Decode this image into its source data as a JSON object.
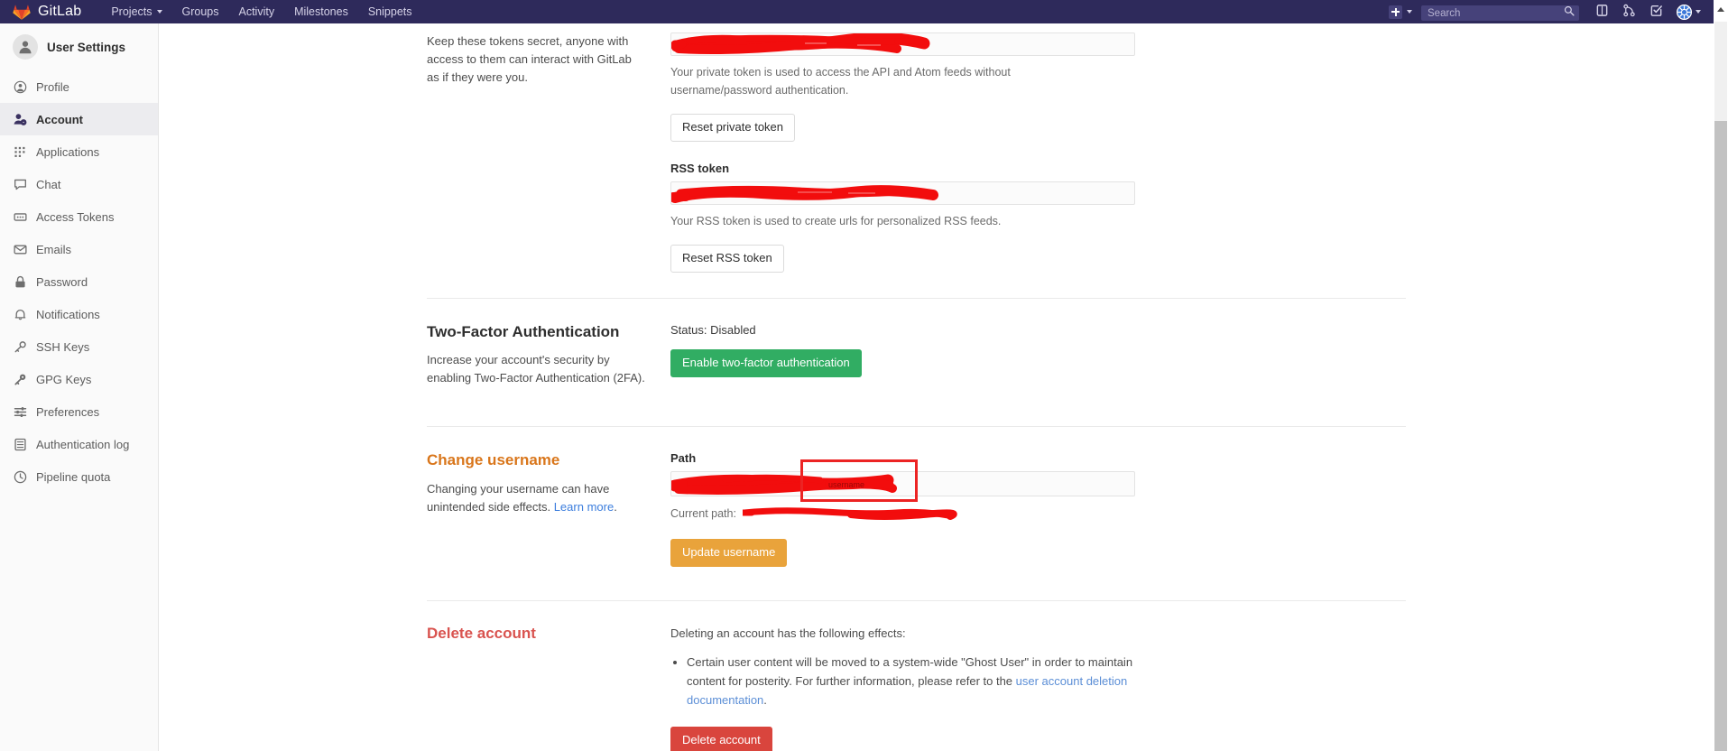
{
  "navbar": {
    "brand": "GitLab",
    "links": [
      {
        "label": "Projects",
        "has_caret": true
      },
      {
        "label": "Groups",
        "has_caret": false
      },
      {
        "label": "Activity",
        "has_caret": false
      },
      {
        "label": "Milestones",
        "has_caret": false
      },
      {
        "label": "Snippets",
        "has_caret": false
      }
    ],
    "search": {
      "placeholder": "Search",
      "value": ""
    },
    "icons": [
      "plus-icon",
      "search-icon",
      "issues-icon",
      "merge-requests-icon",
      "todos-icon",
      "avatar-icon"
    ]
  },
  "sidebar": {
    "title": "User Settings",
    "items": [
      {
        "label": "Profile",
        "icon": "user-circle-icon",
        "active": false
      },
      {
        "label": "Account",
        "icon": "user-gear-icon",
        "active": true
      },
      {
        "label": "Applications",
        "icon": "grid-dots-icon",
        "active": false
      },
      {
        "label": "Chat",
        "icon": "comment-icon",
        "active": false
      },
      {
        "label": "Access Tokens",
        "icon": "token-card-icon",
        "active": false
      },
      {
        "label": "Emails",
        "icon": "envelope-icon",
        "active": false
      },
      {
        "label": "Password",
        "icon": "lock-icon",
        "active": false
      },
      {
        "label": "Notifications",
        "icon": "bell-icon",
        "active": false
      },
      {
        "label": "SSH Keys",
        "icon": "key-icon",
        "active": false
      },
      {
        "label": "GPG Keys",
        "icon": "key-filled-icon",
        "active": false
      },
      {
        "label": "Preferences",
        "icon": "sliders-icon",
        "active": false
      },
      {
        "label": "Authentication log",
        "icon": "list-document-icon",
        "active": false
      },
      {
        "label": "Pipeline quota",
        "icon": "clock-icon",
        "active": false
      }
    ]
  },
  "main": {
    "tokens": {
      "description": "Keep these tokens secret, anyone with access to them can interact with GitLab as if they were you.",
      "private_token": {
        "value": "",
        "redacted": true,
        "help": "Your private token is used to access the API and Atom feeds without username/password authentication.",
        "reset_label": "Reset private token"
      },
      "rss_token": {
        "label": "RSS token",
        "value": "",
        "redacted": true,
        "help": "Your RSS token is used to create urls for personalized RSS feeds.",
        "reset_label": "Reset RSS token"
      }
    },
    "two_factor": {
      "title": "Two-Factor Authentication",
      "description": "Increase your account's security by enabling Two-Factor Authentication (2FA).",
      "status": "Status: Disabled",
      "enable_label": "Enable two-factor authentication"
    },
    "change_username": {
      "title": "Change username",
      "description_before": "Changing your username can have unintended side effects. ",
      "learn_more": "Learn more",
      "description_after": ".",
      "path_label": "Path",
      "path_value": "",
      "path_redacted": true,
      "current_path_label": "Current path:",
      "current_path_value": "",
      "current_path_redacted": true,
      "update_label": "Update username"
    },
    "delete_account": {
      "title": "Delete account",
      "intro": "Deleting an account has the following effects:",
      "bullet_before": "Certain user content will be moved to a system-wide \"Ghost User\" in order to maintain content for posterity. For further information, please refer to the ",
      "bullet_link": "user account deletion documentation",
      "bullet_after": ".",
      "delete_label": "Delete account"
    }
  },
  "colors": {
    "navbar_bg": "#2e2a5b",
    "accent_green": "#31ad63",
    "accent_orange": "#e9a33b",
    "accent_red": "#d9453d",
    "annotation_red": "#ec2323",
    "link_blue": "#3b7ddd"
  }
}
